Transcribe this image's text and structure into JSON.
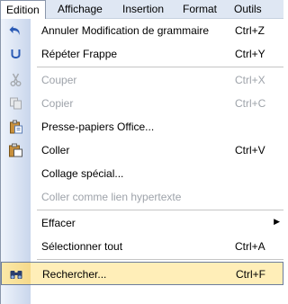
{
  "menubar": {
    "items": [
      {
        "label": "Edition"
      },
      {
        "label": "Affichage"
      },
      {
        "label": "Insertion"
      },
      {
        "label": "Format"
      },
      {
        "label": "Outils"
      }
    ]
  },
  "menu": {
    "items": [
      {
        "label": "Annuler Modification de grammaire",
        "shortcut": "Ctrl+Z",
        "icon": "undo-icon"
      },
      {
        "label": "Répéter Frappe",
        "shortcut": "Ctrl+Y",
        "icon": "redo-icon"
      },
      {
        "label": "Couper",
        "shortcut": "Ctrl+X",
        "icon": "cut-icon"
      },
      {
        "label": "Copier",
        "shortcut": "Ctrl+C",
        "icon": "copy-icon"
      },
      {
        "label": "Presse-papiers Office...",
        "shortcut": "",
        "icon": "clipboard-icon"
      },
      {
        "label": "Coller",
        "shortcut": "Ctrl+V",
        "icon": "paste-icon"
      },
      {
        "label": "Collage spécial...",
        "shortcut": ""
      },
      {
        "label": "Coller comme lien hypertexte",
        "shortcut": ""
      },
      {
        "label": "Effacer",
        "shortcut": "",
        "submenu_arrow": "▶"
      },
      {
        "label": "Sélectionner tout",
        "shortcut": "Ctrl+A"
      },
      {
        "label": "Rechercher...",
        "shortcut": "Ctrl+F",
        "icon": "find-icon"
      }
    ]
  },
  "colors": {
    "menubar_bg": "#dfe7f3",
    "gutter": "#c9d6ec",
    "highlight": "#ffeeb8",
    "disabled_text": "#9ea3aa"
  }
}
